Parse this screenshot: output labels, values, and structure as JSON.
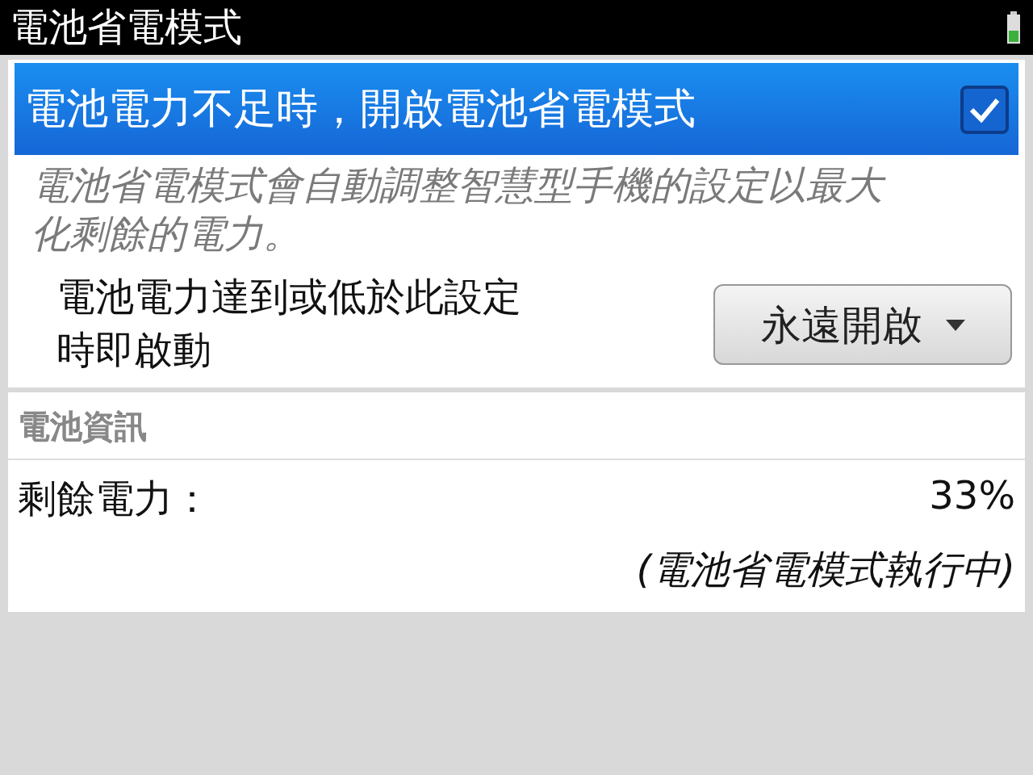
{
  "window": {
    "title": "電池省電模式"
  },
  "saver_toggle": {
    "label": "電池電力不足時，開啟電池省電模式",
    "checked": true,
    "selected": true
  },
  "description": "電池省電模式會自動調整智慧型手機的設定以最大化剩餘的電力。",
  "trigger": {
    "label": "電池電力達到或低於此設定時即啟動",
    "value": "永遠開啟"
  },
  "battery_info": {
    "heading": "電池資訊",
    "remaining_label": "剩餘電力：",
    "remaining_value": "33%",
    "status": "(電池省電模式執行中)"
  }
}
